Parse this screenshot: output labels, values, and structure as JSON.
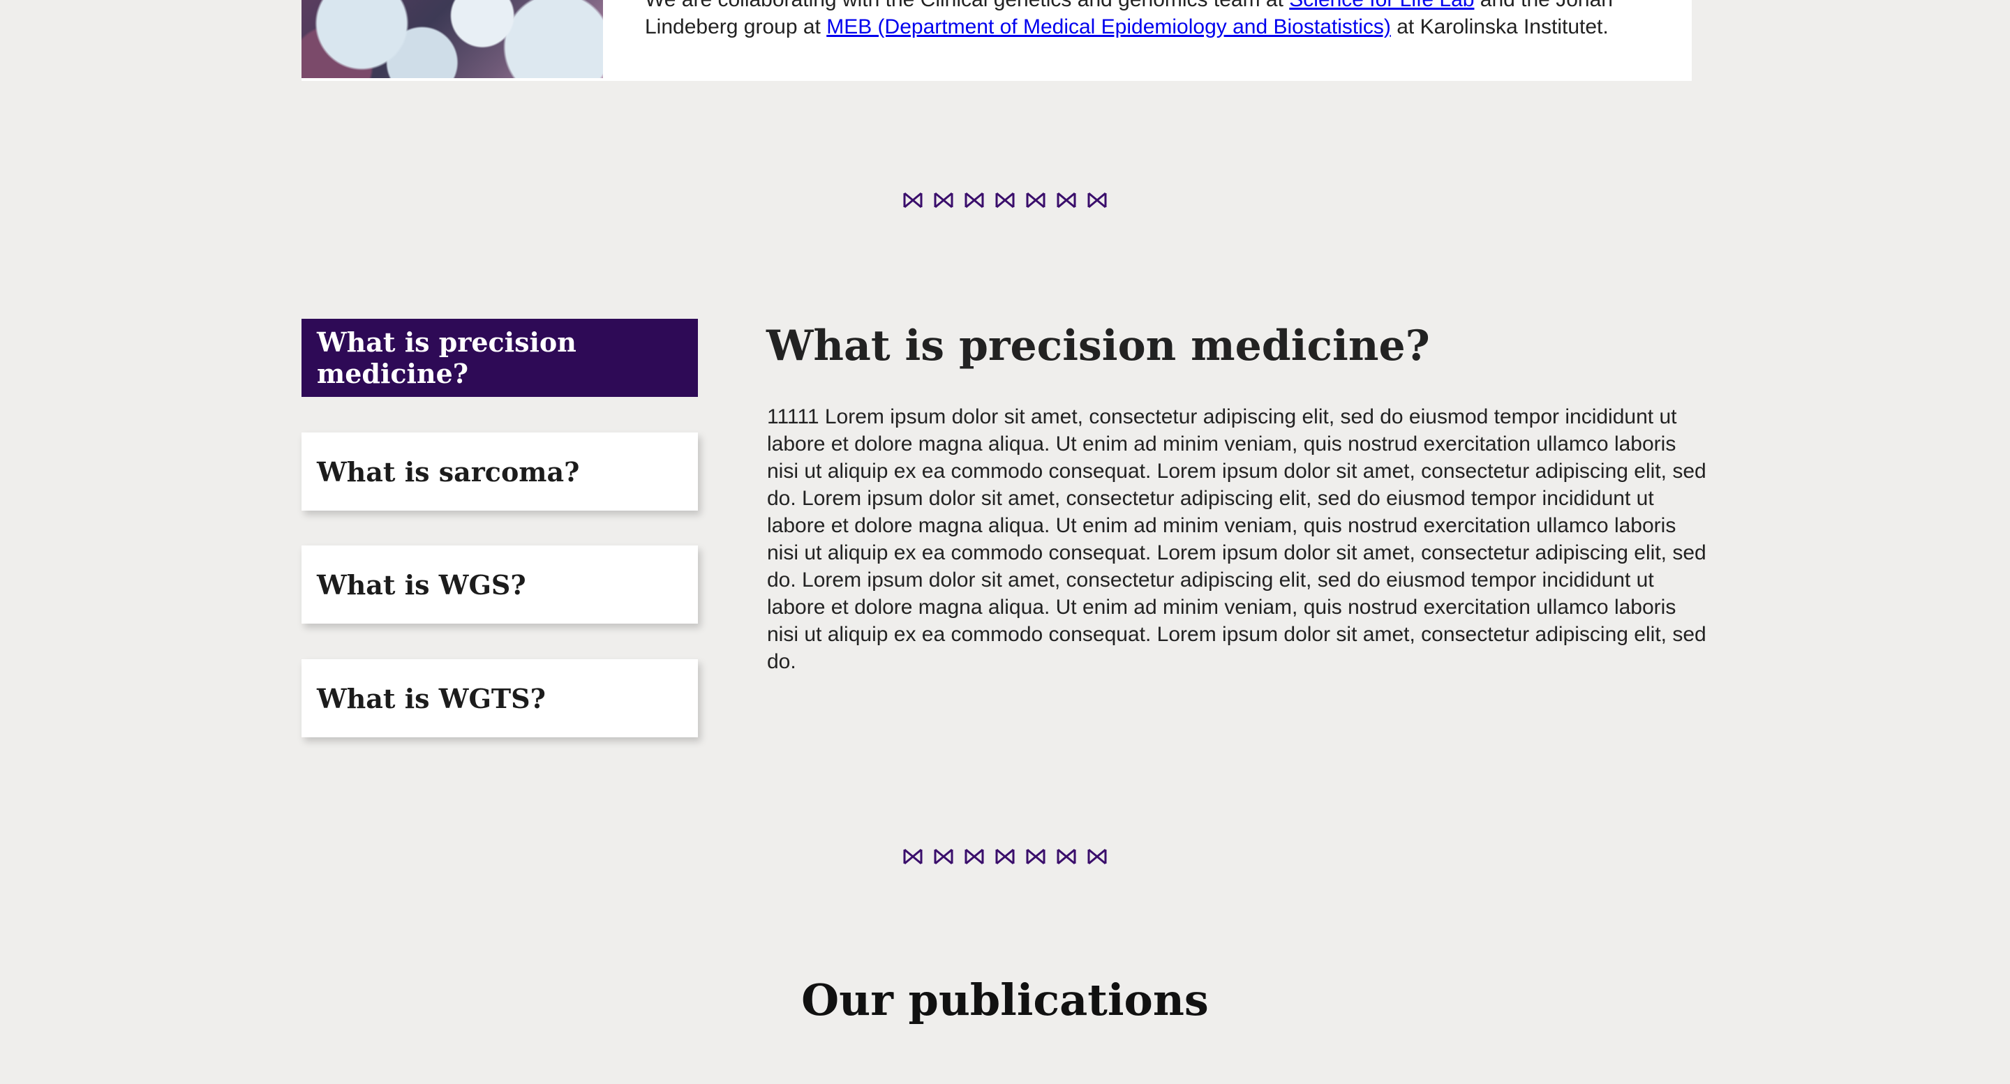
{
  "collaboration": {
    "text_before": "We are collaborating with the Clinical genetics and genomics team at ",
    "link1": "Science for Life Lab",
    "text_middle": " and the Johan Lindeberg group at ",
    "link2": "MEB (Department of Medical Epidemiology and Biostatistics)",
    "text_after": " at Karolinska Institutet."
  },
  "separator": {
    "icon": "dna-icon",
    "count": 7,
    "color": "#3a0e6b"
  },
  "tabs": [
    {
      "label": "What is precision medicine?",
      "active": true
    },
    {
      "label": "What is sarcoma?",
      "active": false
    },
    {
      "label": "What is WGS?",
      "active": false
    },
    {
      "label": "What is WGTS?",
      "active": false
    }
  ],
  "content": {
    "title": "What is precision medicine?",
    "body": "11111 Lorem ipsum dolor sit amet, consectetur adipiscing elit, sed do eiusmod tempor incididunt ut labore et dolore magna aliqua. Ut enim ad minim veniam, quis nostrud exercitation ullamco laboris nisi ut aliquip ex ea commodo consequat. Lorem ipsum dolor sit amet, consectetur adipiscing elit, sed do. Lorem ipsum dolor sit amet, consectetur adipiscing elit, sed do eiusmod tempor incididunt ut labore et dolore magna aliqua. Ut enim ad minim veniam, quis nostrud exercitation ullamco laboris nisi ut aliquip ex ea commodo consequat. Lorem ipsum dolor sit amet, consectetur adipiscing elit, sed do. Lorem ipsum dolor sit amet, consectetur adipiscing elit, sed do eiusmod tempor incididunt ut labore et dolore magna aliqua. Ut enim ad minim veniam, quis nostrud exercitation ullamco laboris nisi ut aliquip ex ea commodo consequat. Lorem ipsum dolor sit amet, consectetur adipiscing elit, sed do."
  },
  "publications": {
    "title": "Our publications"
  },
  "colors": {
    "accent": "#2e0a56",
    "background": "#efeeec",
    "link": "#0000ee"
  }
}
